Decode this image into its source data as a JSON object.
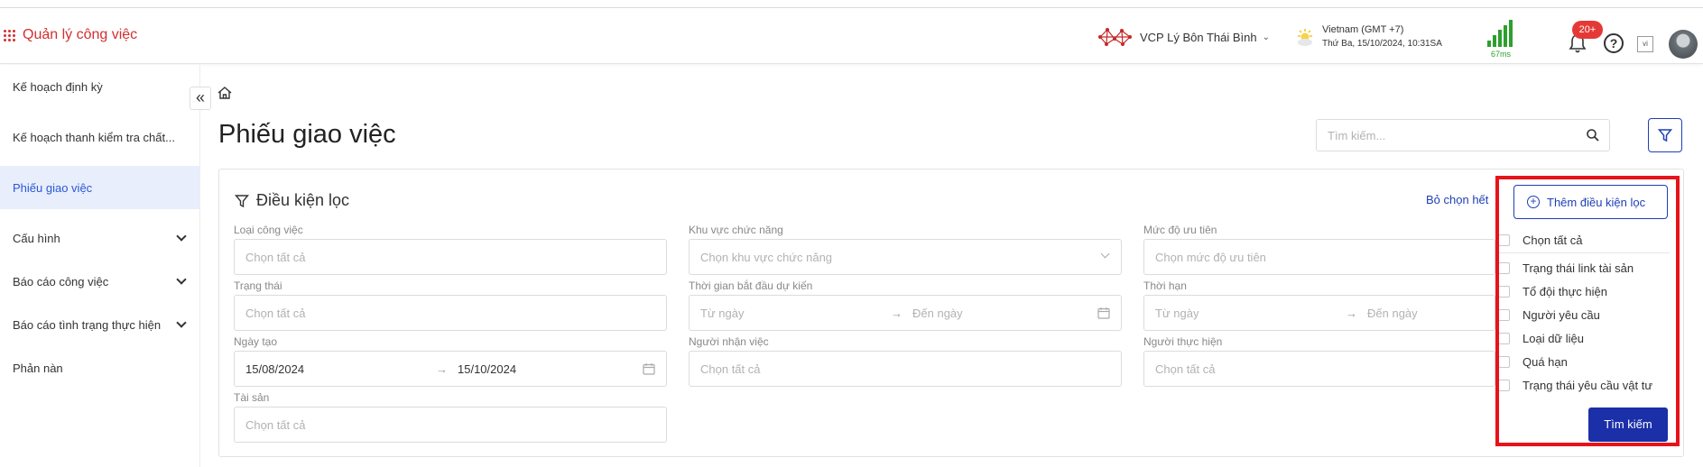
{
  "header": {
    "app_title": "Quản lý công việc",
    "org_name": "VCP Lý Bôn Thái Bình",
    "timezone": "Vietnam (GMT +7)",
    "datetime": "Thứ Ba, 15/10/2024, 10:31SA",
    "ping": "67ms",
    "notification_count": "20+",
    "help_label": "?",
    "language": "vi"
  },
  "sidebar": {
    "items": [
      {
        "label": "Kế hoạch định kỳ"
      },
      {
        "label": "Kế hoạch thanh kiểm tra chất..."
      },
      {
        "label": "Phiếu giao việc"
      },
      {
        "label": "Cấu hình"
      },
      {
        "label": "Báo cáo công việc"
      },
      {
        "label": "Báo cáo tình trạng thực hiện"
      },
      {
        "label": "Phản nàn"
      }
    ],
    "collapse_label": "«"
  },
  "main": {
    "page_title": "Phiếu giao việc",
    "search_placeholder": "Tìm kiếm..."
  },
  "filter_panel": {
    "title": "Điều kiện lọc",
    "clear_all": "Bỏ chọn hết",
    "fields": {
      "loai_cong_viec": {
        "label": "Loại công việc",
        "placeholder": "Chọn tất cả"
      },
      "khu_vuc": {
        "label": "Khu vực chức năng",
        "placeholder": "Chọn khu vực chức năng"
      },
      "muc_do": {
        "label": "Mức độ ưu tiên",
        "placeholder": "Chọn mức độ ưu tiên"
      },
      "trang_thai": {
        "label": "Trạng thái",
        "placeholder": "Chọn tất cả"
      },
      "thoi_gian": {
        "label": "Thời gian bắt đầu dự kiến",
        "from": "Từ ngày",
        "to": "Đến ngày"
      },
      "thoi_han": {
        "label": "Thời hạn",
        "from": "Từ ngày",
        "to": "Đến ngày"
      },
      "ngay_tao": {
        "label": "Ngày tạo",
        "from": "15/08/2024",
        "to": "15/10/2024"
      },
      "nguoi_nhan": {
        "label": "Người nhận việc",
        "placeholder": "Chọn tất cả"
      },
      "nguoi_thuc_hien": {
        "label": "Người thực hiện",
        "placeholder": "Chọn tất cả"
      },
      "tai_san": {
        "label": "Tài sản",
        "placeholder": "Chọn tất cả"
      }
    },
    "range_arrow": "→"
  },
  "add_filter": {
    "button_label": "Thêm điều kiện lọc",
    "select_all": "Chọn tất cả",
    "options": [
      "Trạng thái link tài sản",
      "Tổ đội thực hiện",
      "Người yêu cầu",
      "Loại dữ liệu",
      "Quá hạn",
      "Trạng thái yêu cầu vật tư"
    ],
    "submit_label": "Tìm kiếm"
  },
  "colors": {
    "brand_red": "#d32f2f",
    "primary_blue": "#1f3fb5",
    "highlight_red": "#e8131a",
    "signal_green": "#2e9f2e"
  }
}
